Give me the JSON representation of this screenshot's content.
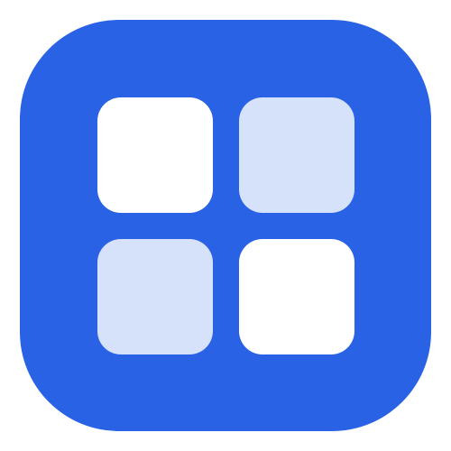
{
  "icon": {
    "name": "app-grid-icon",
    "colors": {
      "background": "#FFFFFF",
      "tile_base": "#2A62E6",
      "square_solid": "#FFFFFF",
      "square_soft": "#D6E1FA"
    },
    "squares": [
      {
        "position": "top-left",
        "style": "solid"
      },
      {
        "position": "top-right",
        "style": "soft"
      },
      {
        "position": "bottom-left",
        "style": "soft"
      },
      {
        "position": "bottom-right",
        "style": "solid"
      }
    ]
  }
}
